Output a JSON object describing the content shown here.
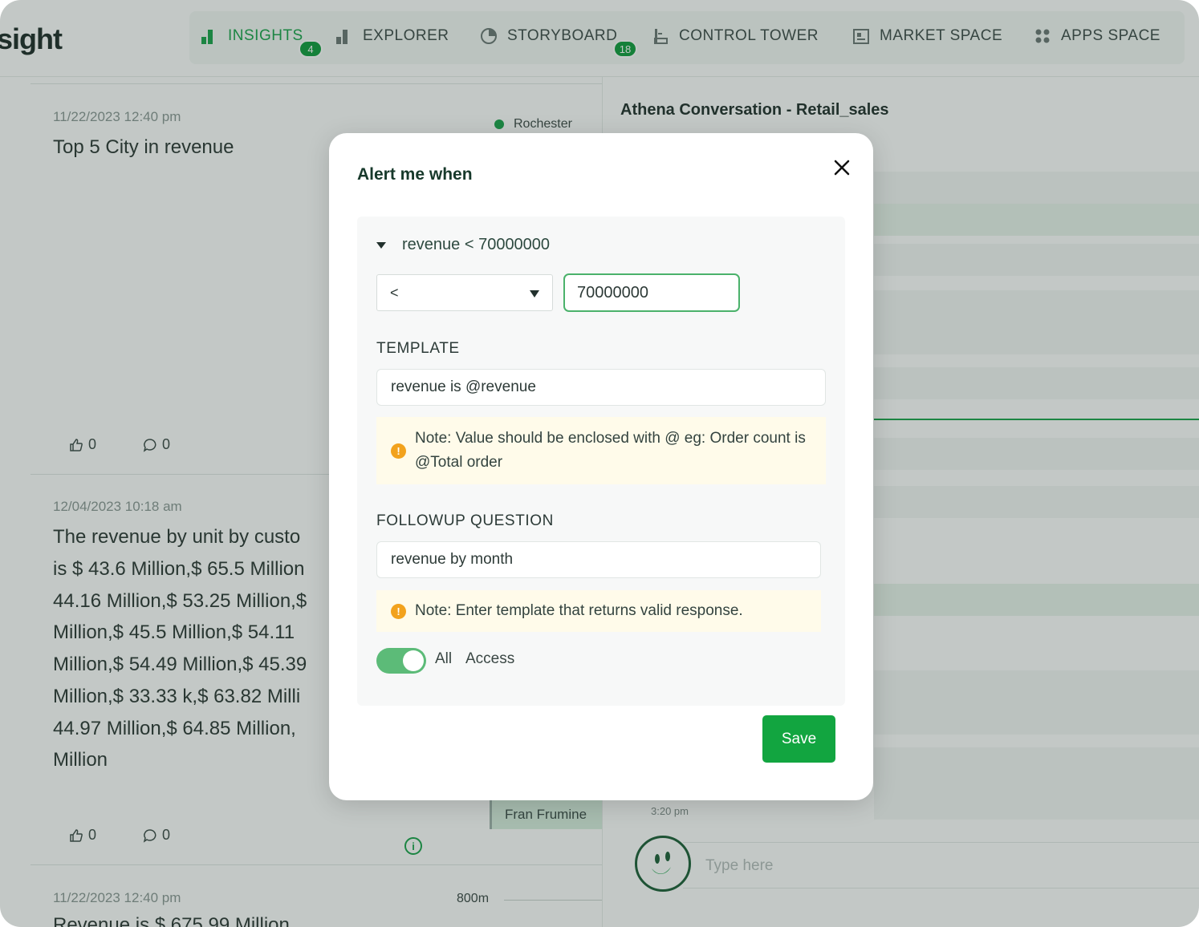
{
  "app": {
    "logo": "sight"
  },
  "nav": {
    "items": [
      {
        "label": "INSIGHTS",
        "badge": "4",
        "icon": "bar-chart-icon",
        "active": true
      },
      {
        "label": "EXPLORER",
        "icon": "explorer-chart-icon"
      },
      {
        "label": "STORYBOARD",
        "badge": "18",
        "icon": "pie-chart-icon"
      },
      {
        "label": "CONTROL TOWER",
        "icon": "tower-icon"
      },
      {
        "label": "MARKET SPACE",
        "icon": "market-icon"
      },
      {
        "label": "APPS SPACE",
        "icon": "apps-grid-icon"
      }
    ]
  },
  "feed": {
    "cards": [
      {
        "timestamp": "11/22/2023 12:40 pm",
        "title": "Top 5 City in revenue",
        "tag": "Rochester",
        "likes": "0",
        "comments": "0"
      },
      {
        "timestamp": "12/04/2023 10:18 am",
        "lines": [
          "The revenue by unit by custo",
          "is $ 43.6 Million,$ 65.5 Million",
          "44.16 Million,$ 53.25 Million,$",
          "Million,$ 45.5 Million,$ 54.11",
          "Million,$ 54.49 Million,$ 45.39",
          "Million,$ 33.33 k,$ 63.82 Milli",
          "44.97 Million,$ 64.85 Million,",
          "Million"
        ],
        "tag": "Fran Frumine",
        "likes": "0",
        "comments": "0"
      },
      {
        "timestamp": "11/22/2023 12:40 pm",
        "title": "Revenue is $ 675.99 Million",
        "axis_label": "800m"
      }
    ]
  },
  "right_panel": {
    "title": "Athena Conversation - Retail_sales",
    "time": "3:20 pm",
    "input_placeholder": "Type here"
  },
  "modal": {
    "title": "Alert me when",
    "condition_summary": "revenue < 70000000",
    "operator": "<",
    "threshold": "70000000",
    "template_label": "TEMPLATE",
    "template_value": "revenue is @revenue",
    "template_note": "Note: Value should be enclosed with @ eg: Order count is @Total order",
    "followup_label": "FOLLOWUP QUESTION",
    "followup_value": "revenue by month",
    "followup_note": "Note: Enter template that returns valid response.",
    "toggle_label_1": "All",
    "toggle_label_2": "Access",
    "toggle_on": true,
    "save_label": "Save"
  },
  "colors": {
    "accent": "#12a540",
    "toggle": "#5cbb78",
    "note_bg": "#fffbea",
    "warn": "#f2a21d"
  }
}
